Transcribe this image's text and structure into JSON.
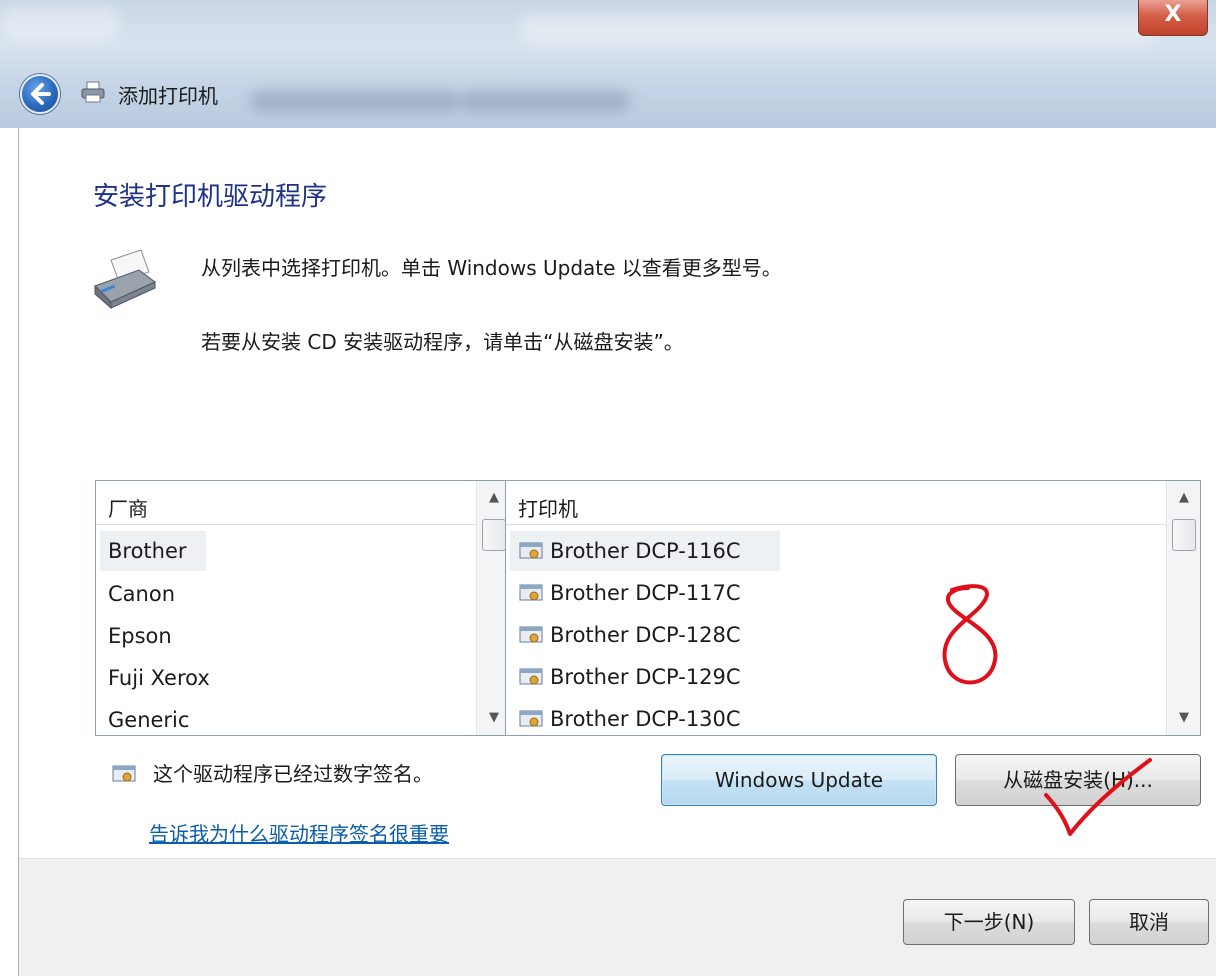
{
  "window": {
    "title": "添加打印机",
    "close_label": "X"
  },
  "page": {
    "heading": "安装打印机驱动程序",
    "desc_line1": "从列表中选择打印机。单击 Windows Update 以查看更多型号。",
    "desc_line2": "若要从安装 CD 安装驱动程序，请单击“从磁盘安装”。"
  },
  "manufacturers": {
    "header": "厂商",
    "items": [
      "Brother",
      "Canon",
      "Epson",
      "Fuji Xerox",
      "Generic"
    ],
    "selected": "Brother"
  },
  "printers": {
    "header": "打印机",
    "items": [
      "Brother DCP-116C",
      "Brother DCP-117C",
      "Brother DCP-128C",
      "Brother DCP-129C",
      "Brother DCP-130C"
    ],
    "selected": "Brother DCP-116C"
  },
  "signature": {
    "text": "这个驱动程序已经过数字签名。",
    "link": "告诉我为什么驱动程序签名很重要"
  },
  "buttons": {
    "windows_update": "Windows Update",
    "have_disk": "从磁盘安装(H)...",
    "next": "下一步(N)",
    "cancel": "取消"
  },
  "annotation": {
    "number": "8",
    "color": "#e0101a"
  },
  "icons": [
    "back-arrow-icon",
    "printer-icon",
    "driver-certificate-icon",
    "scroll-up-icon",
    "scroll-down-icon"
  ]
}
